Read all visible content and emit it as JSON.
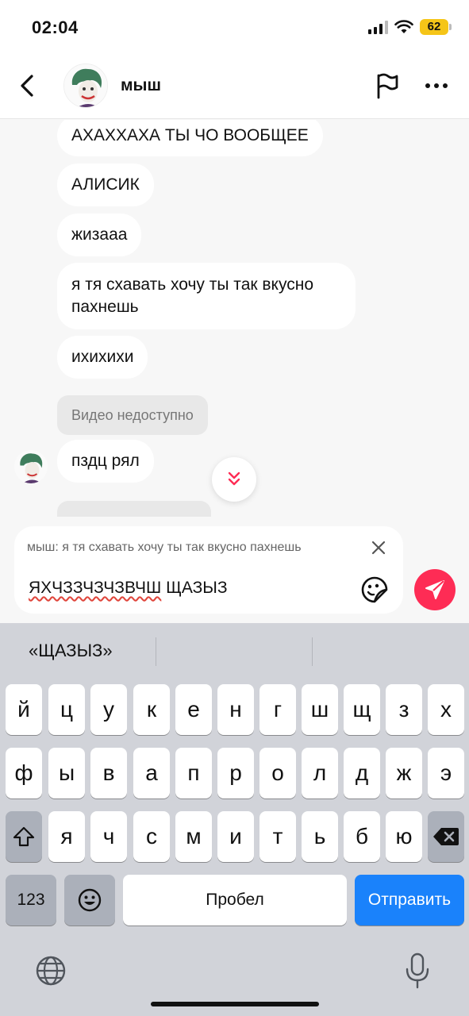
{
  "status_bar": {
    "time": "02:04",
    "battery": "62"
  },
  "header": {
    "contact_name": "мыш"
  },
  "messages": [
    {
      "text": "АХАХХАХА ТЫ ЧО ВООБЩЕЕ"
    },
    {
      "text": "АЛИСИК"
    },
    {
      "text": "жизааа"
    },
    {
      "line1": "я тя схавать хочу ты так вкусно",
      "line2": "пахнешь"
    },
    {
      "text": "ихихихи"
    },
    {
      "text": "Видео недоступно"
    },
    {
      "text": "пздц рял"
    }
  ],
  "composer": {
    "reply_preview": "мыш: я тя схавать хочу ты так вкусно пахнешь",
    "input_misspelled": "ЯХЧЗЗЧЗЧЗВЧШ",
    "input_rest": " ЩАЗЫЗ"
  },
  "keyboard": {
    "suggestion": "«ЩАЗЫЗ»",
    "row1": [
      "й",
      "ц",
      "у",
      "к",
      "е",
      "н",
      "г",
      "ш",
      "щ",
      "з",
      "х"
    ],
    "row2": [
      "ф",
      "ы",
      "в",
      "а",
      "п",
      "р",
      "о",
      "л",
      "д",
      "ж",
      "э"
    ],
    "row3": [
      "я",
      "ч",
      "с",
      "м",
      "и",
      "т",
      "ь",
      "б",
      "ю"
    ],
    "numbers_key": "123",
    "space_key": "Пробел",
    "send_key": "Отправить"
  },
  "colors": {
    "accent": "#fe2c55",
    "keyboard_send": "#1a82fb",
    "battery": "#f5c518"
  }
}
